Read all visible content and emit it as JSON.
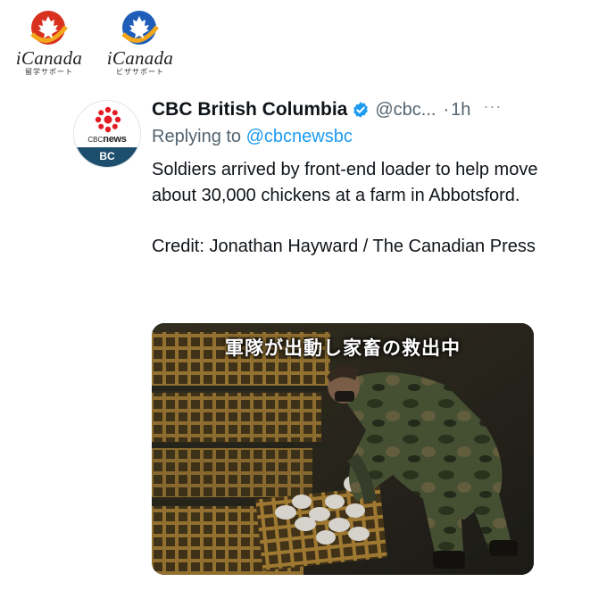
{
  "watermarks": [
    {
      "name": "iCanada",
      "subtitle": "留学サポート",
      "icon": "red-maple-leaf-logo",
      "color": "#d9311f"
    },
    {
      "name": "iCanada",
      "subtitle": "ビザサポート",
      "icon": "blue-maple-leaf-logo",
      "color": "#1f5eb8"
    }
  ],
  "tweet": {
    "author": {
      "display_name": "CBC British Columbia",
      "handle": "@cbc...",
      "verified": true,
      "avatar": {
        "brand_prefix": "CBC",
        "brand_main": "news",
        "region": "BC",
        "icon": "cbc-gem-icon"
      }
    },
    "separator": "·",
    "timestamp": "1h",
    "more_label": "···",
    "replying_to_prefix": "Replying to",
    "replying_to_handle": "@cbcnewsbc",
    "body": {
      "text": "Soldiers arrived by front-end loader to help move about 30,000 chickens at a farm in Abbotsford.",
      "credit": "Credit: Jonathan Hayward / The Canadian Press"
    },
    "media": {
      "caption": "軍隊が出動し家畜の救出中",
      "subject": "soldier-lifting-crate-of-chickens-photo"
    }
  },
  "colors": {
    "link": "#1d9bf0",
    "verified": "#1d9bf0",
    "secondary_text": "#536471",
    "cbc_red": "#e31b23",
    "cbc_bc_blue": "#1d4e6e"
  }
}
